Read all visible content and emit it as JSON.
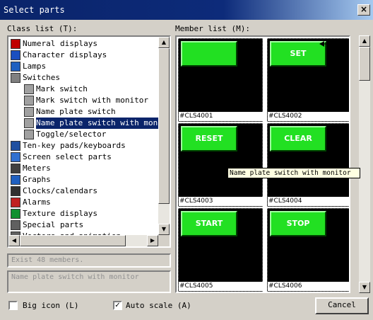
{
  "window": {
    "title": "Select parts",
    "close_symbol": "×"
  },
  "class_list": {
    "label": "Class list (T):",
    "items": [
      {
        "label": "Numeral displays",
        "icon": "numeral-display-icon",
        "indent": 0,
        "selected": false
      },
      {
        "label": "Character displays",
        "icon": "character-display-icon",
        "indent": 0,
        "selected": false
      },
      {
        "label": "Lamps",
        "icon": "lamp-icon",
        "indent": 0,
        "selected": false
      },
      {
        "label": "Switches",
        "icon": "switch-folder-icon",
        "indent": 0,
        "selected": false
      },
      {
        "label": "Mark switch",
        "icon": "switch-icon",
        "indent": 1,
        "selected": false
      },
      {
        "label": "Mark switch with monitor",
        "icon": "switch-icon",
        "indent": 1,
        "selected": false
      },
      {
        "label": "Name plate switch",
        "icon": "switch-icon",
        "indent": 1,
        "selected": false
      },
      {
        "label": "Name plate switch with moni",
        "icon": "switch-icon",
        "indent": 1,
        "selected": true
      },
      {
        "label": "Toggle/selector",
        "icon": "switch-icon",
        "indent": 1,
        "selected": false
      },
      {
        "label": "Ten-key pads/keyboards",
        "icon": "keypad-icon",
        "indent": 0,
        "selected": false
      },
      {
        "label": "Screen select parts",
        "icon": "screen-select-icon",
        "indent": 0,
        "selected": false
      },
      {
        "label": "Meters",
        "icon": "meter-icon",
        "indent": 0,
        "selected": false
      },
      {
        "label": "Graphs",
        "icon": "graph-icon",
        "indent": 0,
        "selected": false
      },
      {
        "label": "Clocks/calendars",
        "icon": "clock-icon",
        "indent": 0,
        "selected": false
      },
      {
        "label": "Alarms",
        "icon": "alarm-icon",
        "indent": 0,
        "selected": false
      },
      {
        "label": "Texture displays",
        "icon": "texture-icon",
        "indent": 0,
        "selected": false
      },
      {
        "label": "Special parts",
        "icon": "special-parts-icon",
        "indent": 0,
        "selected": false
      },
      {
        "label": "Vectors and animation",
        "icon": "vector-icon",
        "indent": 0,
        "selected": false
      }
    ]
  },
  "exist_members": "Exist 48 members.",
  "description": "Name plate switch with monitor",
  "member_list": {
    "label": "Member list (M):",
    "items": [
      {
        "id": "#CLS4001",
        "button_label": ""
      },
      {
        "id": "#CLS4002",
        "button_label": "SET"
      },
      {
        "id": "#CLS4003",
        "button_label": "RESET"
      },
      {
        "id": "#CLS4004",
        "button_label": "CLEAR"
      },
      {
        "id": "#CLS4005",
        "button_label": "START"
      },
      {
        "id": "#CLS4006",
        "button_label": "STOP"
      }
    ]
  },
  "tooltip": "Name plate switch with monitor",
  "options": {
    "big_icon": {
      "label": "Big icon (L)",
      "checked": false
    },
    "auto_scale": {
      "label": "Auto scale (A)",
      "checked": true
    }
  },
  "cancel_label": "Cancel",
  "colors": {
    "accent": "#0a246a",
    "switch_green": "#22e022",
    "cell_bg": "#000000",
    "tooltip_bg": "#ffffe1"
  }
}
